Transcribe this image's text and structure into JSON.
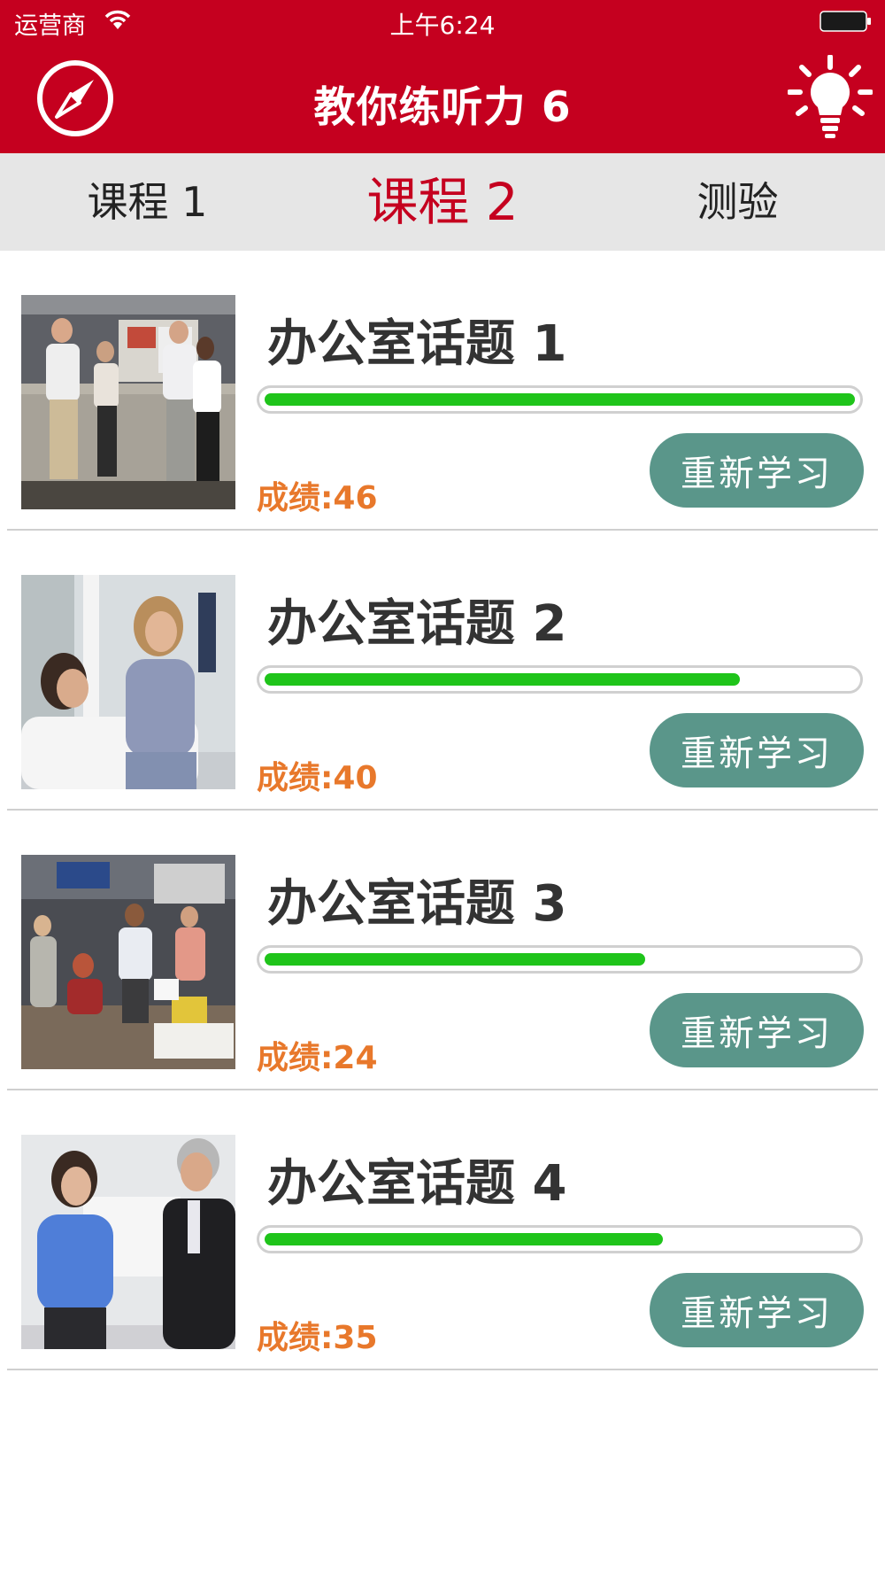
{
  "status_bar": {
    "carrier": "运营商",
    "time": "上午6:24"
  },
  "header": {
    "title": "教你练听力 6",
    "left_icon": "compass-icon",
    "right_icon": "lightbulb-icon",
    "color": "#c5001f"
  },
  "tabs": [
    {
      "label": "课程 1",
      "active": false
    },
    {
      "label": "课程 2",
      "active": true
    },
    {
      "label": "测验",
      "active": false
    }
  ],
  "lessons": [
    {
      "title": "办公室话题 1",
      "progress": 1.0,
      "score": "成绩:46",
      "button": "重新学习"
    },
    {
      "title": "办公室话题 2",
      "progress": 0.805,
      "score": "成绩:40",
      "button": "重新学习"
    },
    {
      "title": "办公室话题 3",
      "progress": 0.645,
      "score": "成绩:24",
      "button": "重新学习"
    },
    {
      "title": "办公室话题 4",
      "progress": 0.675,
      "score": "成绩:35",
      "button": "重新学习"
    }
  ],
  "colors": {
    "accent": "#c5001f",
    "progress": "#1fc41a",
    "score": "#e8782b",
    "button": "#5a968a"
  }
}
